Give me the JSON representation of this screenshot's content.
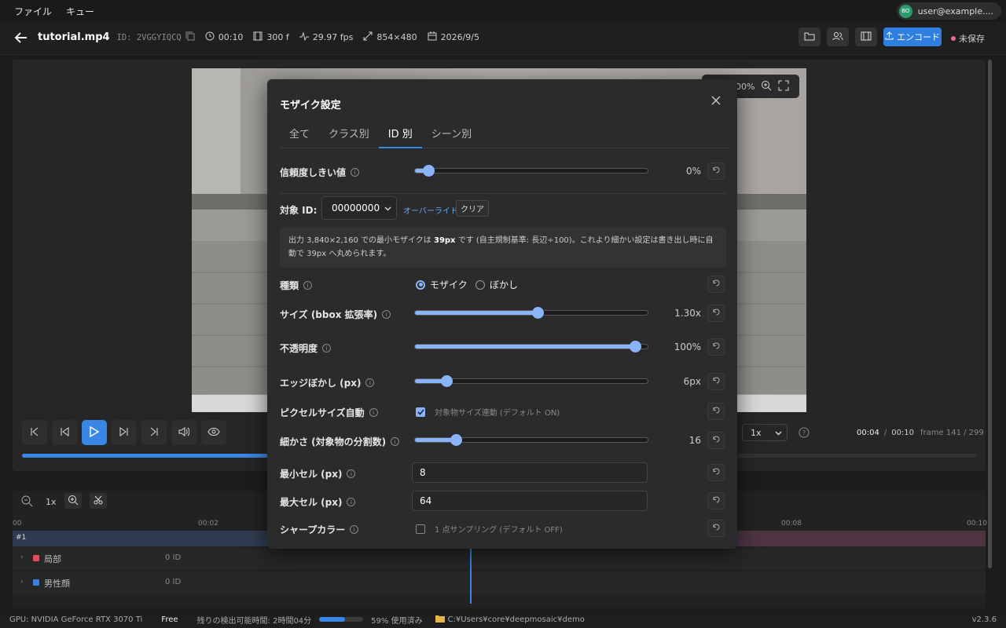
{
  "menu": [
    "ファイル",
    "キュー"
  ],
  "user": {
    "initials": "BO",
    "email": "user@example...."
  },
  "header": {
    "title": "tutorial.mp4",
    "id_label": "ID: 2VGGYIQCQ",
    "duration": "00:10",
    "frames": "300 f",
    "fps": "29.97 fps",
    "resolution": "854×480",
    "date": "2026/9/5",
    "encode_label": "エンコード",
    "save_status": "未保存"
  },
  "zoom": {
    "value": "100%"
  },
  "player": {
    "speed": "1x",
    "current": "00:04",
    "sep": "/",
    "total": "00:10",
    "frame": "frame 141 / 299",
    "progress": 0.26
  },
  "timeline": {
    "zoom": "1x",
    "ticks": [
      "00",
      "00:02",
      "00:08",
      "00:10"
    ],
    "track_label": "#1",
    "rows": [
      {
        "name": "局部",
        "count": "0 ID",
        "color": "#e84b5a"
      },
      {
        "name": "男性顔",
        "count": "0 ID",
        "color": "#3a7fe0"
      }
    ]
  },
  "status": {
    "gpu": "GPU: NVIDIA GeForce RTX 3070 Ti",
    "plan": "Free",
    "remaining": "残りの検出可能時間: 2時間04分",
    "usage": "59% 使用済み",
    "usage_fraction": 0.59,
    "path": "C:¥Users¥core¥deepmosaic¥demo",
    "version": "v2.3.6"
  },
  "modal": {
    "title": "モザイク設定",
    "tabs": [
      "全て",
      "クラス別",
      "ID 別",
      "シーン別"
    ],
    "active_tab": 2,
    "confidence": {
      "label": "信頼度しきい値",
      "value": "0%",
      "fraction": 0.06
    },
    "target": {
      "label": "対象 ID:",
      "value": "00000000",
      "override": "オーバーライド中",
      "clear": "クリア"
    },
    "note_parts": [
      "出力 3,840×2,160 での最小モザイクは ",
      "39px",
      " です (自主規制基準: 長辺÷100)。これより細かい設定は書き出し時に自動で 39px へ丸められます。"
    ],
    "type": {
      "label": "種類",
      "opt1": "モザイク",
      "opt2": "ぼかし"
    },
    "size": {
      "label": "サイズ (bbox 拡張率)",
      "value": "1.30x",
      "fraction": 0.53
    },
    "opacity": {
      "label": "不透明度",
      "value": "100%",
      "fraction": 0.95
    },
    "edge": {
      "label": "エッジぼかし (px)",
      "value": "6px",
      "fraction": 0.14
    },
    "pixel_auto": {
      "label": "ピクセルサイズ自動",
      "desc": "対象物サイズ連動 (デフォルト ON)",
      "checked": true
    },
    "fineness": {
      "label": "細かさ (対象物の分割数)",
      "value": "16",
      "fraction": 0.18
    },
    "min_cell": {
      "label": "最小セル (px)",
      "value": "8"
    },
    "max_cell": {
      "label": "最大セル (px)",
      "value": "64"
    },
    "sharp": {
      "label": "シャープカラー",
      "desc": "1 点サンプリング (デフォルト OFF)",
      "checked": false
    }
  }
}
